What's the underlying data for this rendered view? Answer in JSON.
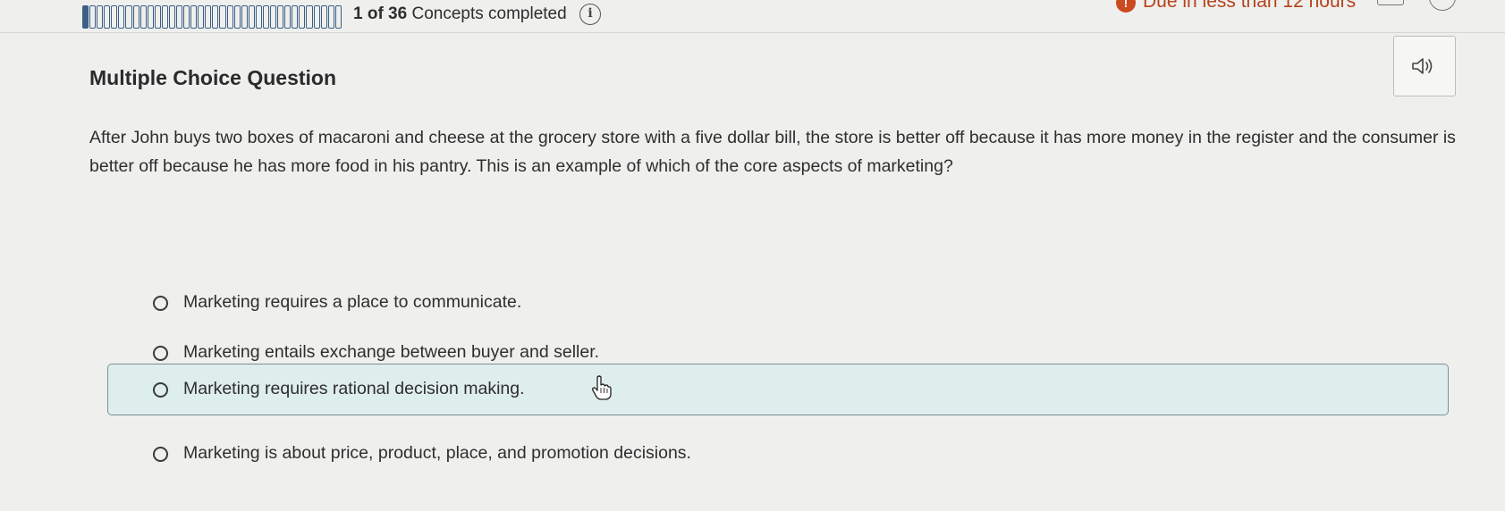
{
  "progress": {
    "completed": 1,
    "total": 36,
    "text_count": "1 of 36",
    "text_label": "Concepts completed"
  },
  "due": {
    "text": "Due in less than 12 hours"
  },
  "question": {
    "type_label": "Multiple Choice Question",
    "prompt": "After John buys two boxes of macaroni and cheese at the grocery store with a five dollar bill, the store is better off because it has more money in the register and the consumer is better off because he has more food in his pantry. This is an example of which of the core aspects of marketing?",
    "choices": [
      {
        "label": "Marketing requires a place to communicate."
      },
      {
        "label": "Marketing entails exchange between buyer and seller."
      },
      {
        "label": "Marketing requires rational decision making."
      },
      {
        "label": "Marketing is about price, product, place, and promotion decisions."
      }
    ],
    "hovered_choice_index": 2
  },
  "icons": {
    "info": "info-icon",
    "audio": "speaker-icon",
    "alert": "alert-icon",
    "calendar": "calendar-icon",
    "avatar": "avatar-icon",
    "cursor": "hand-pointer-icon"
  },
  "colors": {
    "progress_fill": "#3d5f86",
    "due_alert": "#cc4a1f",
    "hover_background": "#deeeec"
  }
}
